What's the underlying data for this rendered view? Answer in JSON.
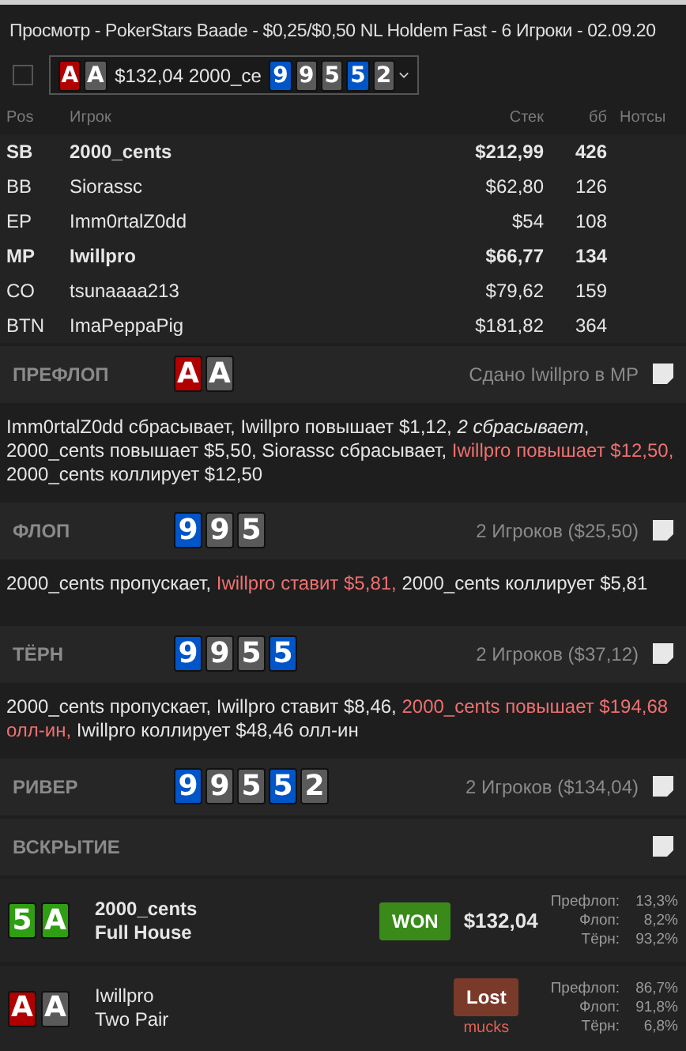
{
  "window": {
    "title": "Просмотр - PokerStars Baade - $0,25/$0,50 NL Holdem Fast - 6 Игроки - 02.09.20"
  },
  "hand_selector": {
    "checked": false,
    "hole_cards": [
      {
        "rank": "A",
        "color": "#b00000"
      },
      {
        "rank": "A",
        "color": "#5a5a5a"
      }
    ],
    "summary": "$132,04 2000_ce",
    "board": [
      {
        "rank": "9",
        "color": "#0055c8"
      },
      {
        "rank": "9",
        "color": "#5a5a5a"
      },
      {
        "rank": "5",
        "color": "#5a5a5a"
      },
      {
        "rank": "5",
        "color": "#0055c8"
      },
      {
        "rank": "2",
        "color": "#5a5a5a"
      }
    ]
  },
  "table": {
    "columns": [
      "Pos",
      "Игрок",
      "Стек",
      "бб",
      "Нотсы"
    ],
    "rows": [
      {
        "pos": "SB",
        "player": "2000_cents",
        "stack": "$212,99",
        "bb": "426",
        "highlighted": true
      },
      {
        "pos": "BB",
        "player": "Siorassc",
        "stack": "$62,80",
        "bb": "126",
        "highlighted": false
      },
      {
        "pos": "EP",
        "player": "Imm0rtalZ0dd",
        "stack": "$54",
        "bb": "108",
        "highlighted": false
      },
      {
        "pos": "MP",
        "player": "Iwillpro",
        "stack": "$66,77",
        "bb": "134",
        "highlighted": true
      },
      {
        "pos": "CO",
        "player": "tsunaaaa213",
        "stack": "$79,62",
        "bb": "159",
        "highlighted": false
      },
      {
        "pos": "BTN",
        "player": "ImaPeppaPig",
        "stack": "$181,82",
        "bb": "364",
        "highlighted": false
      }
    ]
  },
  "streets": [
    {
      "name": "ПРЕФЛОП",
      "cards": [
        {
          "rank": "A",
          "color": "#b00000"
        },
        {
          "rank": "A",
          "color": "#5a5a5a"
        }
      ],
      "info": "Сдано Iwillpro в MP",
      "actions": [
        {
          "text": "Imm0rtalZ0dd сбрасывает, Iwillpro повышает $1,12, ",
          "kind": "normal"
        },
        {
          "text": "2 сбрасывает",
          "kind": "italic"
        },
        {
          "text": ", 2000_cents повышает $5,50, Siorassc сбрасывает, ",
          "kind": "normal"
        },
        {
          "text": "Iwillpro повышает $12,50,",
          "kind": "hero"
        },
        {
          "text": " 2000_cents коллирует $12,50",
          "kind": "normal"
        }
      ]
    },
    {
      "name": "ФЛОП",
      "cards": [
        {
          "rank": "9",
          "color": "#0055c8"
        },
        {
          "rank": "9",
          "color": "#5a5a5a"
        },
        {
          "rank": "5",
          "color": "#5a5a5a"
        }
      ],
      "info": "2 Игроков ($25,50)",
      "actions": [
        {
          "text": "2000_cents пропускает, ",
          "kind": "normal"
        },
        {
          "text": "Iwillpro ставит $5,81,",
          "kind": "hero"
        },
        {
          "text": " 2000_cents коллирует $5,81",
          "kind": "normal"
        }
      ]
    },
    {
      "name": "ТЁРН",
      "cards": [
        {
          "rank": "9",
          "color": "#0055c8"
        },
        {
          "rank": "9",
          "color": "#5a5a5a"
        },
        {
          "rank": "5",
          "color": "#5a5a5a"
        },
        {
          "rank": "5",
          "color": "#0055c8"
        }
      ],
      "info": "2 Игроков ($37,12)",
      "actions": [
        {
          "text": "2000_cents пропускает, Iwillpro ставит $8,46, ",
          "kind": "normal"
        },
        {
          "text": "2000_cents повышает $194,68 олл-ин,",
          "kind": "hero"
        },
        {
          "text": " Iwillpro коллирует $48,46 олл-ин",
          "kind": "normal"
        }
      ]
    },
    {
      "name": "РИВЕР",
      "cards": [
        {
          "rank": "9",
          "color": "#0055c8"
        },
        {
          "rank": "9",
          "color": "#5a5a5a"
        },
        {
          "rank": "5",
          "color": "#5a5a5a"
        },
        {
          "rank": "5",
          "color": "#0055c8"
        },
        {
          "rank": "2",
          "color": "#5a5a5a"
        }
      ],
      "info": "2 Игроков ($134,04)"
    },
    {
      "name": "ВСКРЫТИЕ"
    }
  ],
  "results": [
    {
      "cards": [
        {
          "rank": "5",
          "color": "#2f9e12"
        },
        {
          "rank": "A",
          "color": "#2f9e12"
        }
      ],
      "player": "2000_cents",
      "hand": "Full House",
      "kind": "won",
      "badge": "WON",
      "amount": "$132,04",
      "equity": [
        {
          "label": "Префлоп:",
          "value": "13,3%"
        },
        {
          "label": "Флоп:",
          "value": "8,2%"
        },
        {
          "label": "Тёрн:",
          "value": "93,2%"
        }
      ]
    },
    {
      "cards": [
        {
          "rank": "A",
          "color": "#b00000"
        },
        {
          "rank": "A",
          "color": "#5a5a5a"
        }
      ],
      "player": "Iwillpro",
      "hand": "Two Pair",
      "kind": "lost",
      "badge": "Lost",
      "note": "mucks",
      "equity": [
        {
          "label": "Префлоп:",
          "value": "86,7%"
        },
        {
          "label": "Флоп:",
          "value": "91,8%"
        },
        {
          "label": "Тёрн:",
          "value": "6,8%"
        }
      ]
    }
  ]
}
